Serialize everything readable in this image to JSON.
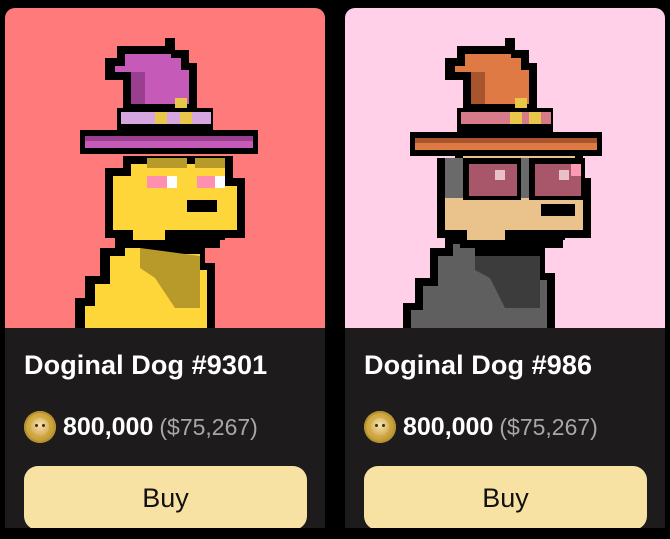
{
  "cards": [
    {
      "title": "Doginal Dog #9301",
      "price": "800,000",
      "price_usd": "($75,267)",
      "buy_label": "Buy",
      "coin_icon": "dogecoin-icon",
      "art": {
        "background": "#ff7a7a",
        "hat": "#c65ab8",
        "hat_dark": "#9a3f8f",
        "body": "#ffd63a",
        "body_shade": "#b79a2a"
      }
    },
    {
      "title": "Doginal Dog #986",
      "price": "800,000",
      "price_usd": "($75,267)",
      "buy_label": "Buy",
      "coin_icon": "dogecoin-icon",
      "art": {
        "background": "#ffd0e8",
        "hat": "#e07a44",
        "hat_dark": "#a8542c",
        "body": "#5f5f5f",
        "face": "#e9c28c",
        "glasses": "#a8566a"
      }
    }
  ]
}
